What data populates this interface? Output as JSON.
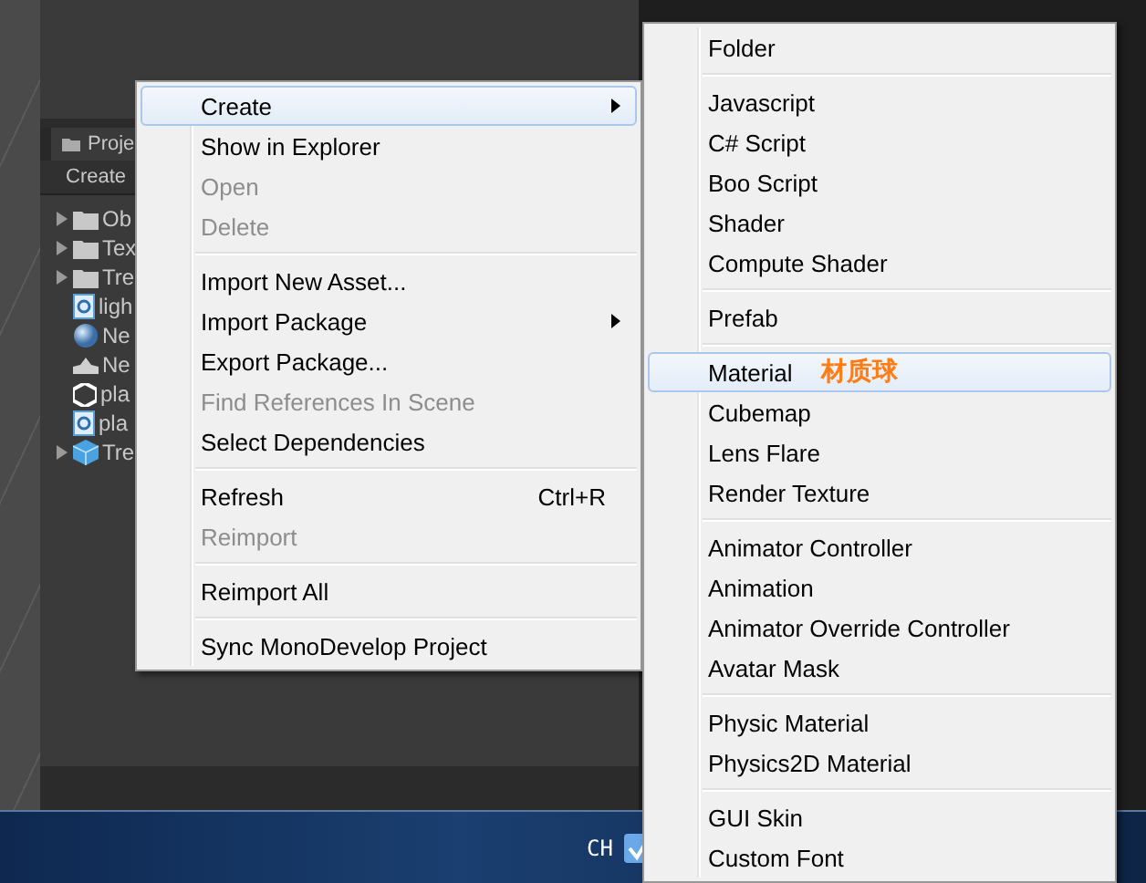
{
  "project_panel": {
    "tab": "Proje",
    "toolbar_button": "Create",
    "items": [
      {
        "kind": "folder",
        "label": "Ob",
        "expanded": false
      },
      {
        "kind": "folder",
        "label": "Tex",
        "expanded": false
      },
      {
        "kind": "folder",
        "label": "Tre",
        "expanded": false
      },
      {
        "kind": "script",
        "label": "ligh"
      },
      {
        "kind": "material",
        "label": "Ne"
      },
      {
        "kind": "terrain",
        "label": "Ne"
      },
      {
        "kind": "scene",
        "label": "pla"
      },
      {
        "kind": "script",
        "label": "pla"
      },
      {
        "kind": "prefab",
        "label": "Tre",
        "expanded": false
      }
    ]
  },
  "context_menu": {
    "groups": [
      [
        {
          "label": "Create",
          "selected": true,
          "disabled": false,
          "submenu": true
        },
        {
          "label": "Show in Explorer",
          "selected": false,
          "disabled": false,
          "submenu": false
        },
        {
          "label": "Open",
          "selected": false,
          "disabled": true,
          "submenu": false
        },
        {
          "label": "Delete",
          "selected": false,
          "disabled": true,
          "submenu": false
        }
      ],
      [
        {
          "label": "Import New Asset...",
          "selected": false,
          "disabled": false,
          "submenu": false
        },
        {
          "label": "Import Package",
          "selected": false,
          "disabled": false,
          "submenu": true
        },
        {
          "label": "Export Package...",
          "selected": false,
          "disabled": false,
          "submenu": false
        },
        {
          "label": "Find References In Scene",
          "selected": false,
          "disabled": true,
          "submenu": false
        },
        {
          "label": "Select Dependencies",
          "selected": false,
          "disabled": false,
          "submenu": false
        }
      ],
      [
        {
          "label": "Refresh",
          "shortcut": "Ctrl+R",
          "selected": false,
          "disabled": false,
          "submenu": false
        },
        {
          "label": "Reimport",
          "selected": false,
          "disabled": true,
          "submenu": false
        }
      ],
      [
        {
          "label": "Reimport All",
          "selected": false,
          "disabled": false,
          "submenu": false
        }
      ],
      [
        {
          "label": "Sync MonoDevelop Project",
          "selected": false,
          "disabled": false,
          "submenu": false
        }
      ]
    ]
  },
  "create_submenu": {
    "groups": [
      [
        {
          "label": "Folder",
          "selected": false
        }
      ],
      [
        {
          "label": "Javascript",
          "selected": false
        },
        {
          "label": "C# Script",
          "selected": false
        },
        {
          "label": "Boo Script",
          "selected": false
        },
        {
          "label": "Shader",
          "selected": false
        },
        {
          "label": "Compute Shader",
          "selected": false
        }
      ],
      [
        {
          "label": "Prefab",
          "selected": false
        }
      ],
      [
        {
          "label": "Material",
          "selected": true,
          "annotation": "材质球"
        },
        {
          "label": "Cubemap",
          "selected": false
        },
        {
          "label": "Lens Flare",
          "selected": false
        },
        {
          "label": "Render Texture",
          "selected": false
        }
      ],
      [
        {
          "label": "Animator Controller",
          "selected": false
        },
        {
          "label": "Animation",
          "selected": false
        },
        {
          "label": "Animator Override Controller",
          "selected": false
        },
        {
          "label": "Avatar Mask",
          "selected": false
        }
      ],
      [
        {
          "label": "Physic Material",
          "selected": false
        },
        {
          "label": "Physics2D Material",
          "selected": false
        }
      ],
      [
        {
          "label": "GUI Skin",
          "selected": false
        },
        {
          "label": "Custom Font",
          "selected": false
        }
      ]
    ]
  },
  "taskbar": {
    "language": "CH"
  }
}
